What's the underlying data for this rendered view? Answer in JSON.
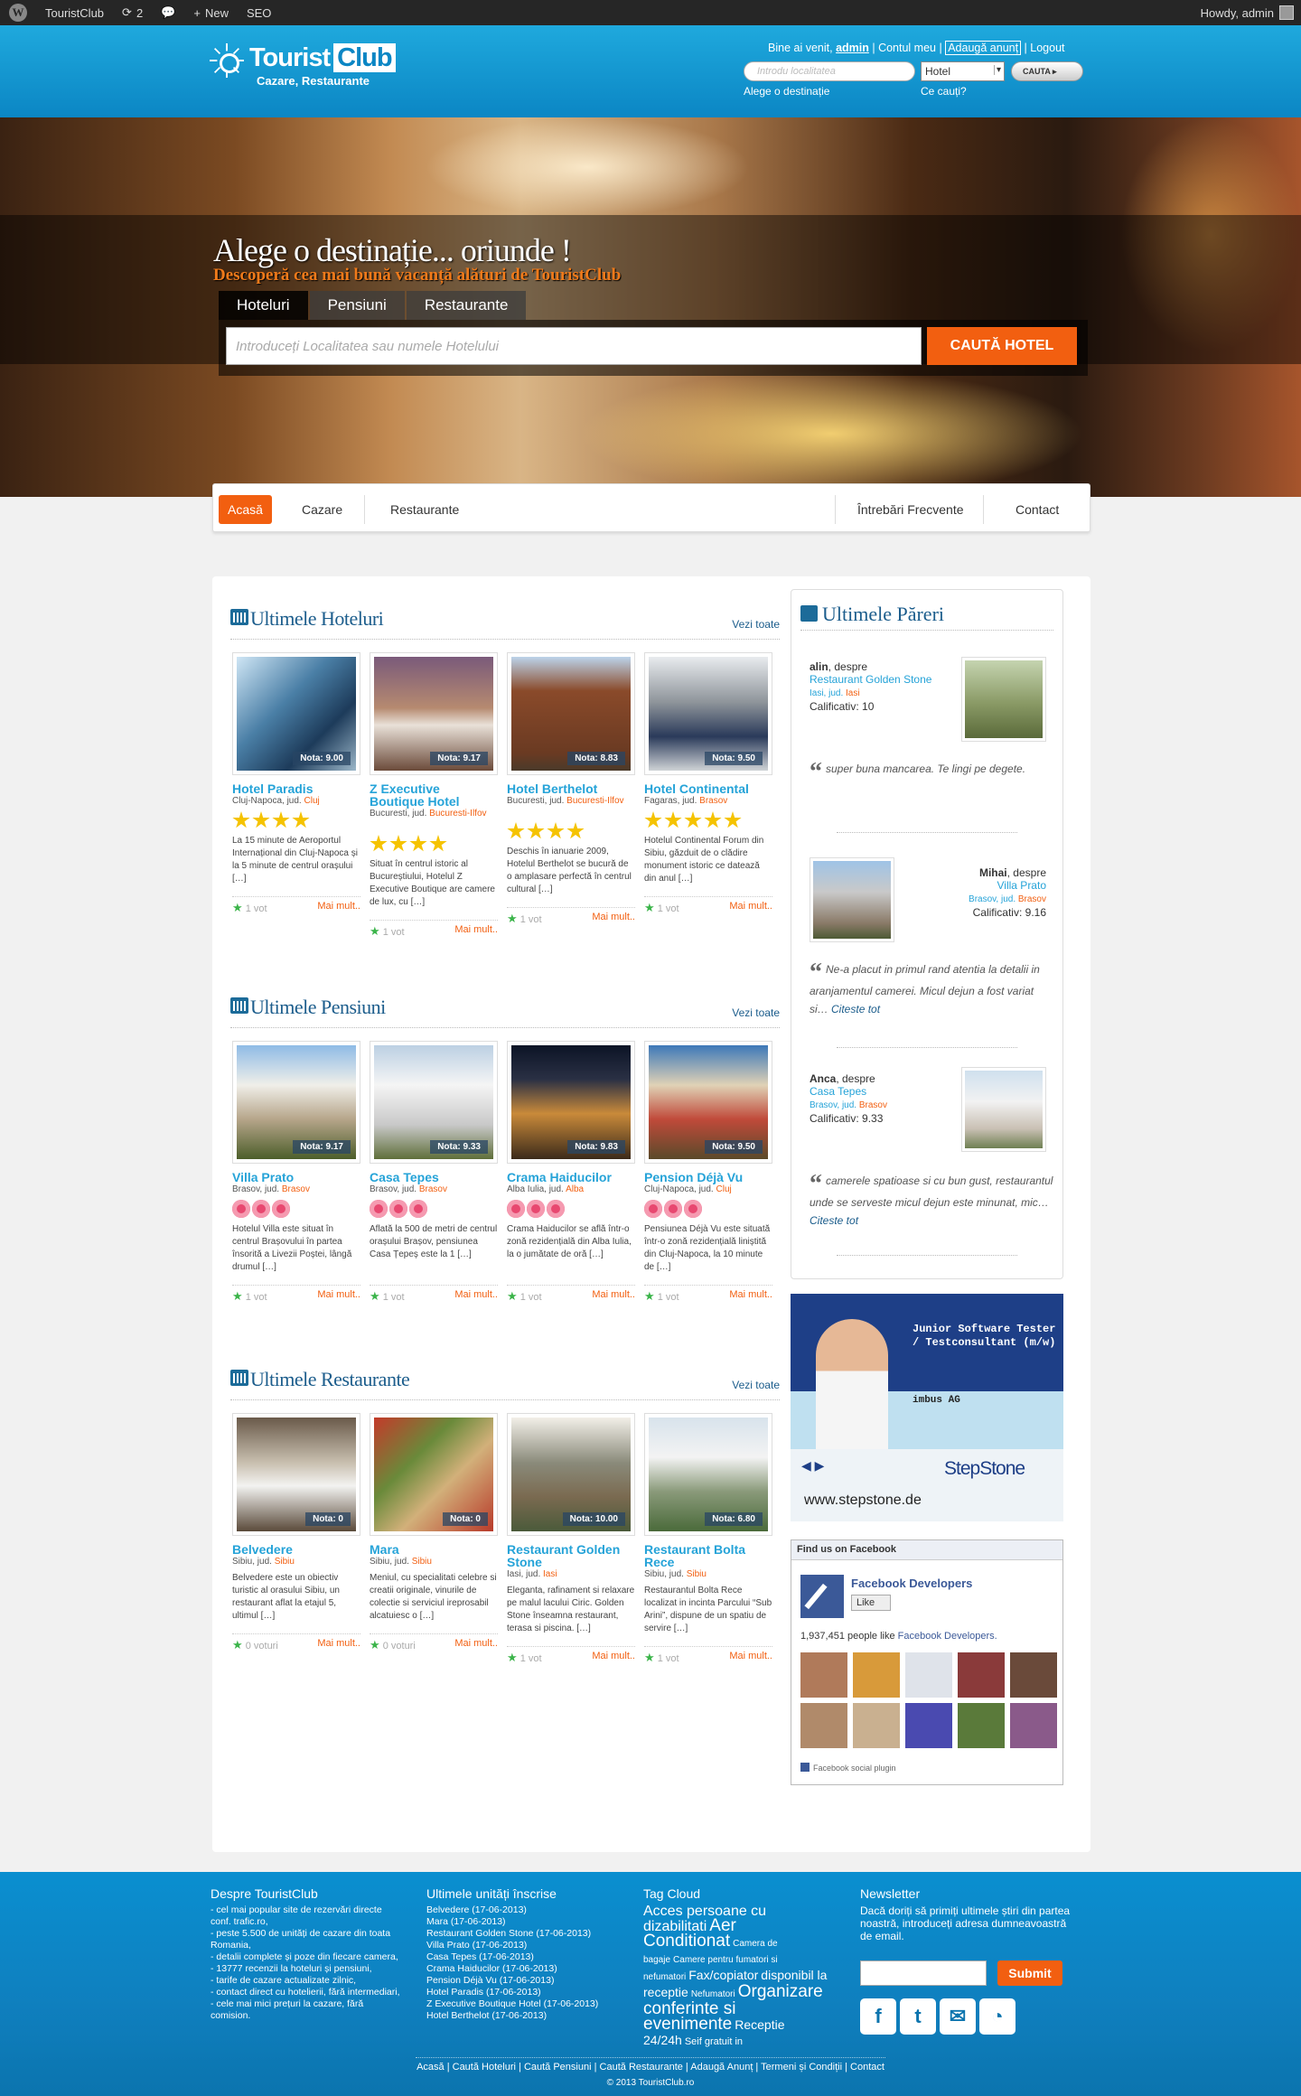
{
  "adminbar": {
    "site": "TouristClub",
    "updates": "2",
    "new": "New",
    "seo": "SEO",
    "howdy": "Howdy, admin"
  },
  "header": {
    "logo_a": "Tourist",
    "logo_b": "Club",
    "logo_sub": "Cazare, Restaurante",
    "welcome": "Bine ai venit,",
    "user": "admin",
    "account": "Contul meu",
    "add_ad": "Adaugă anunț",
    "logout": "Logout",
    "loc_placeholder": "Introdu localitatea",
    "type_value": "Hotel",
    "search_btn": "CAUTA",
    "loc_label": "Alege o destinație",
    "what_label": "Ce cauți?"
  },
  "hero": {
    "title": "Alege o destinație... oriunde !",
    "subtitle": "Descoperă cea mai bună vacanță alături de TouristClub",
    "tabs": [
      "Hoteluri",
      "Pensiuni",
      "Restaurante"
    ],
    "placeholder": "Introduceți Localitatea sau numele Hotelului",
    "button": "CAUTĂ HOTEL"
  },
  "nav": {
    "home": "Acasă",
    "cazare": "Cazare",
    "restaurante": "Restaurante",
    "faq": "Întrebări Frecvente",
    "contact": "Contact"
  },
  "hotels": {
    "title": "Ultimele Hoteluri",
    "all": "Vezi toate",
    "items": [
      {
        "name": "Hotel Paradis",
        "nota": "Nota: 9.00",
        "loc": "Cluj-Napoca, jud.",
        "county": "Cluj",
        "desc": "La 15 minute de Aeroportul Internațional din Cluj-Napoca și la 5 minute de centrul orașului […]",
        "votes": "1 vot",
        "more": "Mai mult.."
      },
      {
        "name": "Z Executive Boutique Hotel",
        "nota": "Nota: 9.17",
        "loc": "Bucuresti, jud.",
        "county": "Bucuresti-Ilfov",
        "desc": "Situat în centrul istoric al Bucureștiului, Hotelul Z Executive Boutique are camere de lux, cu […]",
        "votes": "1 vot",
        "more": "Mai mult.."
      },
      {
        "name": "Hotel Berthelot",
        "nota": "Nota: 8.83",
        "loc": "Bucuresti, jud.",
        "county": "Bucuresti-Ilfov",
        "desc": "Deschis în ianuarie 2009, Hotelul Berthelot se bucură de o amplasare perfectă în centrul cultural […]",
        "votes": "1 vot",
        "more": "Mai mult.."
      },
      {
        "name": "Hotel Continental",
        "nota": "Nota: 9.50",
        "loc": "Fagaras, jud.",
        "county": "Brasov",
        "desc": "Hotelul Continental Forum din Sibiu, găzduit de o clădire monument istoric ce datează din anul […]",
        "votes": "1 vot",
        "more": "Mai mult.."
      }
    ]
  },
  "pensions": {
    "title": "Ultimele Pensiuni",
    "all": "Vezi toate",
    "items": [
      {
        "name": "Villa Prato",
        "nota": "Nota: 9.17",
        "loc": "Brasov, jud.",
        "county": "Brasov",
        "desc": "Hotelul Villa este situat în centrul Brașovului în partea însorită a Livezii Poștei, lângă drumul […]",
        "votes": "1 vot",
        "more": "Mai mult.."
      },
      {
        "name": "Casa Tepes",
        "nota": "Nota: 9.33",
        "loc": "Brasov, jud.",
        "county": "Brasov",
        "desc": "Aflată la 500 de metri de centrul orașului Brașov, pensiunea Casa Țepeș este la 1 […]",
        "votes": "1 vot",
        "more": "Mai mult.."
      },
      {
        "name": "Crama Haiducilor",
        "nota": "Nota: 9.83",
        "loc": "Alba Iulia, jud.",
        "county": "Alba",
        "desc": "Crama Haiducilor se află într-o zonă rezidențială din Alba Iulia, la o jumătate de oră […]",
        "votes": "1 vot",
        "more": "Mai mult.."
      },
      {
        "name": "Pension Déjà Vu",
        "nota": "Nota: 9.50",
        "loc": "Cluj-Napoca, jud.",
        "county": "Cluj",
        "desc": "Pensiunea Déjà Vu este situată într-o zonă rezidențială liniștită din Cluj-Napoca, la 10 minute de […]",
        "votes": "1 vot",
        "more": "Mai mult.."
      }
    ]
  },
  "restaurants": {
    "title": "Ultimele Restaurante",
    "all": "Vezi toate",
    "items": [
      {
        "name": "Belvedere",
        "nota": "Nota: 0",
        "loc": "Sibiu, jud.",
        "county": "Sibiu",
        "desc": "Belvedere este un obiectiv turistic al orasului Sibiu, un restaurant aflat la etajul 5, ultimul […]",
        "votes": "0 voturi",
        "more": "Mai mult.."
      },
      {
        "name": "Mara",
        "nota": "Nota: 0",
        "loc": "Sibiu, jud.",
        "county": "Sibiu",
        "desc": "Meniul, cu specialitati celebre si creatii originale, vinurile de colectie si serviciul ireprosabil alcatuiesc o […]",
        "votes": "0 voturi",
        "more": "Mai mult.."
      },
      {
        "name": "Restaurant Golden Stone",
        "nota": "Nota: 10.00",
        "loc": "Iasi, jud.",
        "county": "Iasi",
        "desc": "Eleganta, rafinament si relaxare pe malul lacului Ciric. Golden Stone înseamna restaurant, terasa si piscina. […]",
        "votes": "1 vot",
        "more": "Mai mult.."
      },
      {
        "name": "Restaurant Bolta Rece",
        "nota": "Nota: 6.80",
        "loc": "Sibiu, jud.",
        "county": "Sibiu",
        "desc": "Restaurantul Bolta Rece localizat in incinta Parcului “Sub Arini”, dispune de un spatiu de servire […]",
        "votes": "1 vot",
        "more": "Mai mult.."
      }
    ]
  },
  "reviews": {
    "title": "Ultimele Păreri",
    "items": [
      {
        "author": "alin",
        "about": ", despre",
        "place": "Restaurant Golden Stone",
        "loc": "Iasi, jud.",
        "county": "Iasi",
        "rating": "Calificativ: 10",
        "quote": "super buna mancarea. Te lingi pe degete.",
        "more": ""
      },
      {
        "author": "Mihai",
        "about": ", despre",
        "place": "Villa Prato",
        "loc": "Brasov, jud.",
        "county": "Brasov",
        "rating": "Calificativ: 9.16",
        "quote": "Ne-a placut in primul rand atentia la detalii in aranjamentul camerei. Micul dejun a fost variat si…",
        "more": "Citeste tot"
      },
      {
        "author": "Anca",
        "about": ", despre",
        "place": "Casa Tepes",
        "loc": "Brasov, jud.",
        "county": "Brasov",
        "rating": "Calificativ: 9.33",
        "quote": "camerele spatioase si cu bun gust, restaurantul unde se serveste micul dejun este minunat, mic…",
        "more": "Citeste tot"
      }
    ]
  },
  "ad": {
    "job": "Junior Software Tester / Testconsultant (m/w)",
    "company": "imbus AG",
    "brand": "StepStone",
    "url": "www.stepstone.de"
  },
  "facebook": {
    "header": "Find us on Facebook",
    "page": "Facebook Developers",
    "like": "Like",
    "count": "1,937,451 people like",
    "count_page": "Facebook Developers.",
    "plugin": "Facebook social plugin"
  },
  "footer": {
    "about_title": "Despre TouristClub",
    "about": [
      "- cel mai popular site de rezervări directe conf. trafic.ro,",
      "- peste 5.500 de unități de cazare din toata Romania,",
      "- detalii complete și poze din fiecare camera,",
      "- 13777 recenzii la hoteluri și pensiuni,",
      "- tarife de cazare actualizate zilnic,",
      "- contact direct cu hotelierii, fără intermediari,",
      "- cele mai mici prețuri la cazare, fără comision."
    ],
    "latest_title": "Ultimele unități înscrise",
    "latest": [
      "Belvedere (17-06-2013)",
      "Mara (17-06-2013)",
      "Restaurant Golden Stone (17-06-2013)",
      "Villa Prato (17-06-2013)",
      "Casa Tepes (17-06-2013)",
      "Crama Haiducilor (17-06-2013)",
      "Pension Déjà Vu (17-06-2013)",
      "Hotel Paradis (17-06-2013)",
      "Z Executive Boutique Hotel (17-06-2013)",
      "Hotel Berthelot (17-06-2013)"
    ],
    "tags_title": "Tag Cloud",
    "tags": [
      "Acces persoane cu dizabilitati",
      "Aer Conditionat",
      "Camera de bagaje",
      "Camere pentru fumatori si nefumatori",
      "Fax/copiator",
      "disponibil la receptie",
      "Nefumatori",
      "Organizare conferinte si evenimente",
      "Receptie 24/24h",
      "Seif gratuit in"
    ],
    "news_title": "Newsletter",
    "news_text": "Dacă doriți să primiți ultimele știri din partea noastră, introduceți adresa dumneavoastră de email.",
    "submit": "Submit",
    "links": [
      "Acasă",
      "Caută Hoteluri",
      "Caută Pensiuni",
      "Caută Restaurante",
      "Adaugă Anunț",
      "Termeni și Condiții",
      "Contact"
    ],
    "copy": "© 2013 TouristClub.ro"
  }
}
